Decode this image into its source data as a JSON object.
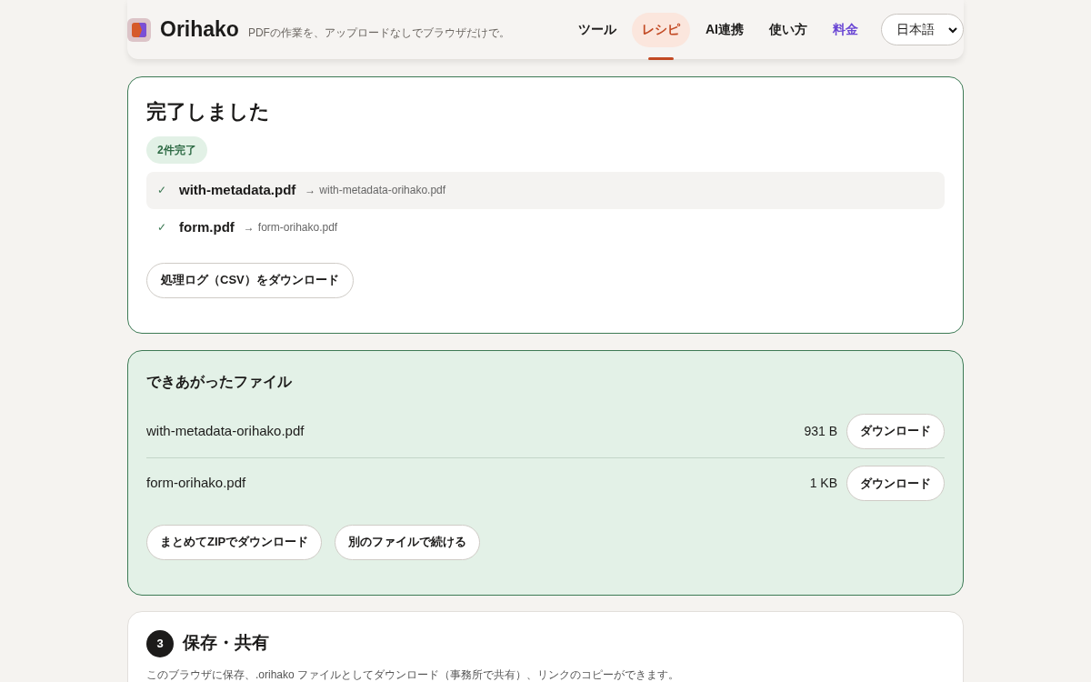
{
  "header": {
    "brand": "Orihako",
    "tagline": "PDFの作業を、アップロードなしでブラウザだけで。",
    "nav": [
      {
        "label": "ツール",
        "selected": false,
        "kind": "plain"
      },
      {
        "label": "レシピ",
        "selected": true,
        "kind": "plain"
      },
      {
        "label": "AI連携",
        "selected": false,
        "kind": "plain"
      },
      {
        "label": "使い方",
        "selected": false,
        "kind": "plain"
      },
      {
        "label": "料金",
        "selected": false,
        "kind": "accent"
      }
    ],
    "language": "日本語"
  },
  "done": {
    "title": "完了しました",
    "badge": "2件完了",
    "files": [
      {
        "source": "with-metadata.pdf",
        "arrow": "→",
        "output": "with-metadata-orihako.pdf",
        "selected": true
      },
      {
        "source": "form.pdf",
        "arrow": "→",
        "output": "form-orihako.pdf",
        "selected": false
      }
    ],
    "check": "✓",
    "log_button": "処理ログ（CSV）をダウンロード"
  },
  "outputs": {
    "title": "できあがったファイル",
    "files": [
      {
        "name": "with-metadata-orihako.pdf",
        "size": "931 B",
        "button": "ダウンロード"
      },
      {
        "name": "form-orihako.pdf",
        "size": "1 KB",
        "button": "ダウンロード"
      }
    ],
    "buttons": [
      "まとめてZIPでダウンロード",
      "別のファイルで続ける"
    ]
  },
  "save": {
    "step": "3",
    "title": "保存・共有",
    "description": "このブラウザに保存、.orihako ファイルとしてダウンロード（事務所で共有）、リンクのコピーができます。"
  }
}
